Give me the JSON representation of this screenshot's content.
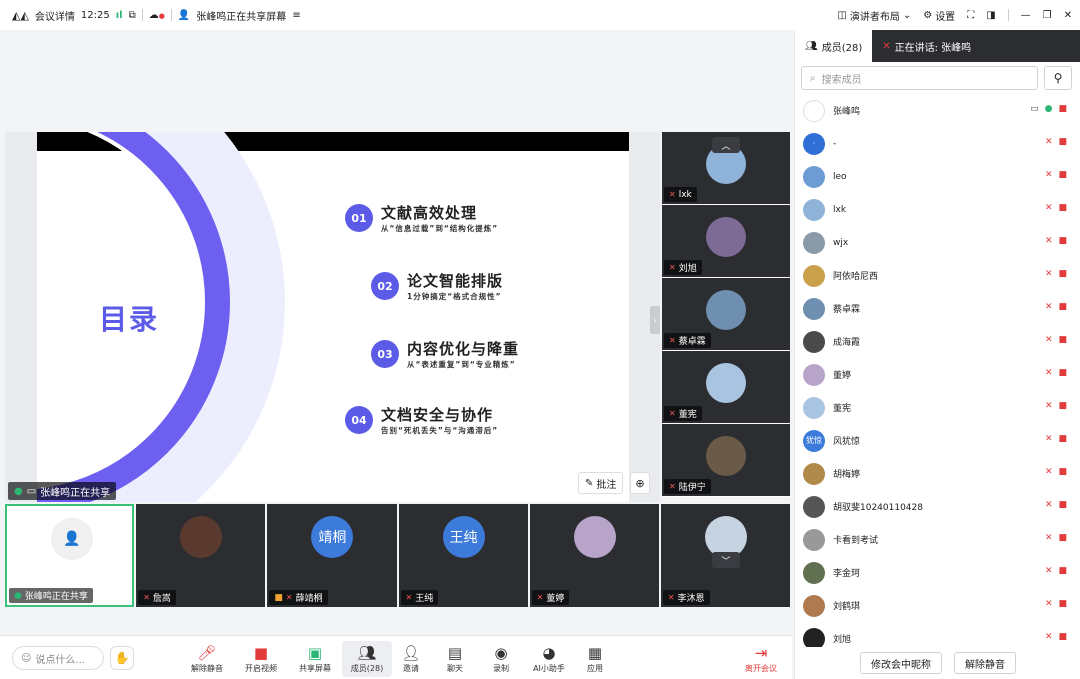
{
  "topbar": {
    "meeting_details": "会议详情",
    "time": "12:25",
    "sharing_status": "张峰鸣正在共享屏幕",
    "layout_label": "演讲者布局",
    "settings_label": "设置"
  },
  "slide": {
    "toc_title": "目录",
    "items": [
      {
        "num": "01",
        "title": "文献高效处理",
        "sub": "从“信息过载”到“结构化提炼”"
      },
      {
        "num": "02",
        "title": "论文智能排版",
        "sub": "1分钟搞定“格式合规性”"
      },
      {
        "num": "03",
        "title": "内容优化与降重",
        "sub": "从“表述重复”到“专业精炼”"
      },
      {
        "num": "04",
        "title": "文档安全与协作",
        "sub": "告别“死机丢失”与“沟通滞后”"
      }
    ]
  },
  "share_label": "张峰鸣正在共享",
  "annotate_label": "批注",
  "side_tiles": [
    {
      "name": "lxk",
      "color": "#8fb3d9"
    },
    {
      "name": "刘旭",
      "color": "#7d6b95"
    },
    {
      "name": "蔡卓霖",
      "color": "#6f8fb0"
    },
    {
      "name": "董宪",
      "color": "#a9c4e0"
    },
    {
      "name": "陆伊宁",
      "color": "#6b5a48"
    },
    {
      "name": "李沐恩",
      "color": "#c6d3e0"
    }
  ],
  "bottom_tiles": [
    {
      "name": "张峰鸣正在共享",
      "avatar": "",
      "color": "#f5f5f5"
    },
    {
      "name": "詹嵩",
      "avatar": "",
      "color": "#5a3a2e"
    },
    {
      "name": "薛靖桐",
      "avatar": "靖桐",
      "color": "#3c7bd9"
    },
    {
      "name": "王纯",
      "avatar": "王纯",
      "color": "#3c7bd9"
    },
    {
      "name": "董婷",
      "avatar": "",
      "color": "#b9a4c9"
    }
  ],
  "toolbar": {
    "chat_placeholder": "说点什么...",
    "buttons": [
      {
        "label": "解除静音",
        "icon": "🎤"
      },
      {
        "label": "开启视频",
        "icon": "📷"
      },
      {
        "label": "共享屏幕",
        "icon": "🖥"
      },
      {
        "label": "成员(28)",
        "icon": "👥"
      },
      {
        "label": "邀请",
        "icon": "👤"
      },
      {
        "label": "聊天",
        "icon": "💬"
      },
      {
        "label": "录制",
        "icon": "⏺"
      },
      {
        "label": "AI小助手",
        "icon": "🤖"
      },
      {
        "label": "应用",
        "icon": "▦"
      }
    ],
    "leave_label": "离开会议"
  },
  "panel": {
    "members_tab": "成员(28)",
    "speaking_label": "正在讲话: 张峰鸣",
    "search_placeholder": "搜索成员",
    "members": [
      {
        "name": "张峰鸣",
        "color": "#ffffff",
        "initials": "",
        "host": true
      },
      {
        "name": "-",
        "color": "#2f6fd6",
        "initials": "·"
      },
      {
        "name": "leo",
        "color": "#6d9bd4",
        "initials": ""
      },
      {
        "name": "lxk",
        "color": "#8fb3d9",
        "initials": ""
      },
      {
        "name": "wjx",
        "color": "#8a9aa8",
        "initials": ""
      },
      {
        "name": "阿依哈尼西",
        "color": "#caa04a",
        "initials": ""
      },
      {
        "name": "蔡卓霖",
        "color": "#6f8fb0",
        "initials": ""
      },
      {
        "name": "成海霞",
        "color": "#4a4a4a",
        "initials": ""
      },
      {
        "name": "董婷",
        "color": "#b9a4c9",
        "initials": ""
      },
      {
        "name": "董宪",
        "color": "#a9c4e0",
        "initials": ""
      },
      {
        "name": "风犹惊",
        "color": "#3c7bd9",
        "initials": "犹惊"
      },
      {
        "name": "胡梅婷",
        "color": "#b08a4a",
        "initials": ""
      },
      {
        "name": "胡驭斐10240110428",
        "color": "#555555",
        "initials": ""
      },
      {
        "name": "卡看到考试",
        "color": "#999999",
        "initials": ""
      },
      {
        "name": "李金珂",
        "color": "#607050",
        "initials": ""
      },
      {
        "name": "刘鹤琪",
        "color": "#b07a50",
        "initials": ""
      },
      {
        "name": "刘旭",
        "color": "#222222",
        "initials": ""
      }
    ],
    "rename_button": "修改会中昵称",
    "unmute_button": "解除静音"
  }
}
